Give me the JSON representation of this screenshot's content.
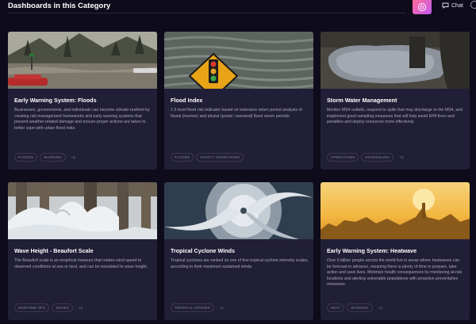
{
  "header": {
    "title": "Dashboards in this Category",
    "chat_label": "Chat",
    "ai_button_icon": "sparkle-face-icon",
    "chat_icon": "chat-bubble-icon",
    "help_icon": "help-icon"
  },
  "colors": {
    "background": "#0e0c1b",
    "card": "#211e37",
    "accent_gradient_start": "#ff6a9b",
    "accent_gradient_end": "#c05cf0"
  },
  "cards": [
    {
      "title": "Early Warning System: Floods",
      "description": "Businesses, governments, and individuals can become climate-resilient by creating risk management frameworks and early warning systems that prevent weather-related damage and ensure proper actions are taken to better cope with urban flood risks.",
      "tags": [
        "FLOODS",
        "WARNING",
        "+1"
      ]
    },
    {
      "title": "Flood Index",
      "description": "1-5 level flood risk indicator based on extensive return period analysis of fluvial (riverine) and pluvial (portal / overland) flood return periods.",
      "tags": [
        "FLOODS",
        "SAFETY OPERATIONS"
      ]
    },
    {
      "title": "Storm Water Management",
      "description": "Monitor MS4 outfalls, respond to spills that may discharge to the MS4, and implement good sampling measures that will help avoid EPA fines and penalties and deploy resources more effectively.",
      "tags": [
        "OPERATIONS",
        "SCHEDULING",
        "+2"
      ]
    },
    {
      "title": "Wave Height - Beaufort Scale",
      "description": "The Beaufort scale is an empirical measure that relates wind speed to observed conditions at sea or land, and can be translated to wave height.",
      "tags": [
        "MARITIME OPS",
        "WAVES",
        "+2"
      ]
    },
    {
      "title": "Tropical Cyclone Winds",
      "description": "Tropical cyclones are ranked on one of five tropical cyclone intensity scales, according to their maximum sustained winds.",
      "tags": [
        "TROPICAL STORMS",
        "+1"
      ]
    },
    {
      "title": "Early Warning System: Heatwave",
      "description": "Over 5 billion people across the world live in areas where heatwaves can be forecast in advance, meaning there is plenty of time to prepare, take action and save lives. Minimize health consequences by monitoring at-risk locations and alerting vulnerable populations with proactive preventative measures.",
      "tags": [
        "HEAT",
        "WARNING",
        "+1"
      ]
    }
  ]
}
